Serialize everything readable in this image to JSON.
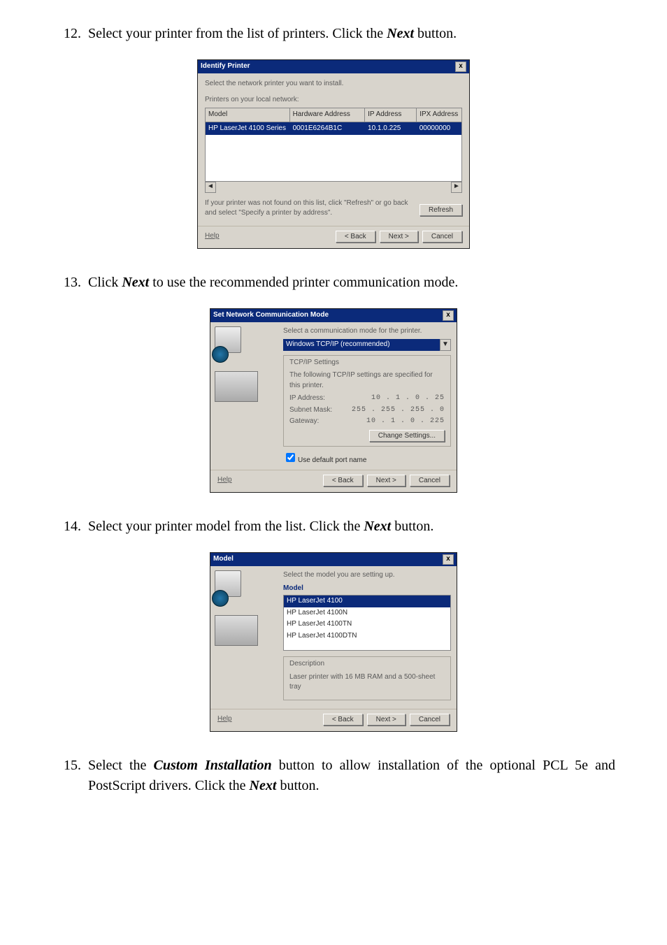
{
  "steps": {
    "12": {
      "num": "12.",
      "pre": "Select your printer from the list of printers.  Click the ",
      "bold": "Next",
      "post": " button."
    },
    "13": {
      "num": "13.",
      "pre": "Click ",
      "bold": "Next",
      "post": " to use the recommended printer communication mode."
    },
    "14": {
      "num": "14.",
      "pre": "Select your printer model from the list.  Click the ",
      "bold": "Next",
      "post": " button."
    },
    "15": {
      "num": "15.",
      "pre": "Select the ",
      "bold": "Custom Installation",
      "mid": " button to allow installation of the optional PCL 5e and PostScript drivers.  Click the ",
      "bold2": "Next",
      "post": " button."
    }
  },
  "dlg1": {
    "title": "Identify Printer",
    "close": "x",
    "prompt": "Select the network printer you want to install.",
    "subprompt": "Printers on your local network:",
    "cols": {
      "a": "Model",
      "b": "Hardware Address",
      "c": "IP Address",
      "d": "IPX Address"
    },
    "row": {
      "a": "HP LaserJet 4100 Series",
      "b": "0001E6264B1C",
      "c": "10.1.0.225",
      "d": "00000000"
    },
    "scrollLeft": "◄",
    "scrollRight": "►",
    "note": "If your printer was not found on this list, click \"Refresh\" or go back and select \"Specify a printer by address\".",
    "refresh": "Refresh",
    "help": "Help",
    "back": "< Back",
    "next": "Next >",
    "cancel": "Cancel"
  },
  "dlg2": {
    "title": "Set Network Communication Mode",
    "close": "x",
    "prompt": "Select a communication mode for the printer.",
    "mode": "Windows TCP/IP (recommended)",
    "ddArrow": "▼",
    "frameTitle": "TCP/IP Settings",
    "frameHint": "The following TCP/IP settings are specified for this printer.",
    "ip_lbl": "IP Address:",
    "ip_val": "10 . 1 . 0 . 25",
    "sm_lbl": "Subnet Mask:",
    "sm_val": "255 . 255 . 255 . 0",
    "gw_lbl": "Gateway:",
    "gw_val": "10 . 1 . 0 . 225",
    "change": "Change Settings...",
    "chk": "Use default port name",
    "help": "Help",
    "back": "< Back",
    "next": "Next >",
    "cancel": "Cancel"
  },
  "dlg3": {
    "title": "Model",
    "close": "x",
    "prompt": "Select the model you are setting up.",
    "listHead": "Model",
    "selItem": "HP LaserJet 4100",
    "items": [
      "HP LaserJet 4100N",
      "HP LaserJet 4100TN",
      "HP LaserJet 4100DTN"
    ],
    "descHead": "Description",
    "desc": "Laser printer with 16 MB RAM and a 500-sheet tray",
    "help": "Help",
    "back": "< Back",
    "next": "Next >",
    "cancel": "Cancel"
  }
}
